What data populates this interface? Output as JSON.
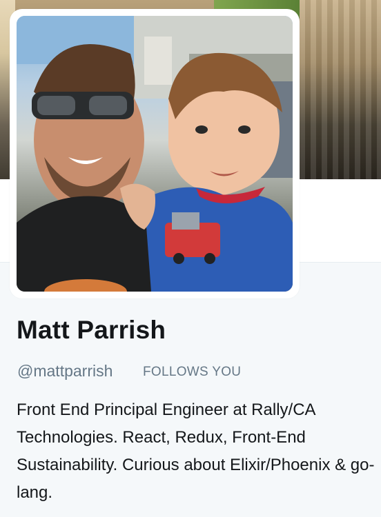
{
  "profile": {
    "name": "Matt Parrish",
    "screen_name": "@mattparrish",
    "follows_you": "FOLLOWS YOU",
    "bio": "Front End Principal Engineer at Rally/CA Technologies. React, Redux, Front-End Sustainability. Curious about Elixir/Phoenix & go-lang."
  },
  "colors": {
    "background": "#f5f8fa",
    "name_text": "#14171a",
    "secondary_text": "#657786"
  }
}
